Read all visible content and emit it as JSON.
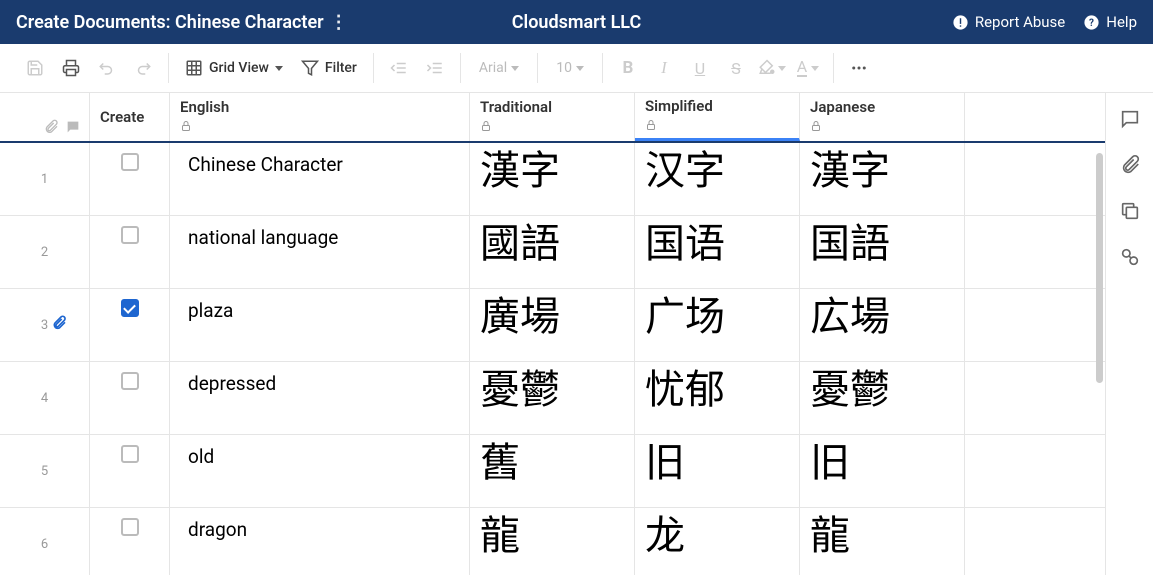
{
  "header": {
    "doc_title": "Create Documents: Chinese Character",
    "org_name": "Cloudsmart LLC",
    "report_abuse": "Report Abuse",
    "help": "Help"
  },
  "toolbar": {
    "view_label": "Grid View",
    "filter_label": "Filter",
    "font_label": "Arial",
    "size_label": "10"
  },
  "columns": {
    "create": "Create",
    "english": "English",
    "traditional": "Traditional",
    "simplified": "Simplified",
    "japanese": "Japanese"
  },
  "rows": [
    {
      "num": "1",
      "checked": false,
      "attach": false,
      "english": "Chinese Character",
      "traditional": "漢字",
      "simplified": "汉字",
      "japanese": "漢字"
    },
    {
      "num": "2",
      "checked": false,
      "attach": false,
      "english": "national language",
      "traditional": "國語",
      "simplified": "国语",
      "japanese": "国語"
    },
    {
      "num": "3",
      "checked": true,
      "attach": true,
      "english": "plaza",
      "traditional": "廣場",
      "simplified": "广场",
      "japanese": "広場"
    },
    {
      "num": "4",
      "checked": false,
      "attach": false,
      "english": "depressed",
      "traditional": "憂鬱",
      "simplified": "忧郁",
      "japanese": "憂鬱"
    },
    {
      "num": "5",
      "checked": false,
      "attach": false,
      "english": "old",
      "traditional": "舊",
      "simplified": "旧",
      "japanese": "旧"
    },
    {
      "num": "6",
      "checked": false,
      "attach": false,
      "english": "dragon",
      "traditional": "龍",
      "simplified": "龙",
      "japanese": "龍"
    }
  ]
}
